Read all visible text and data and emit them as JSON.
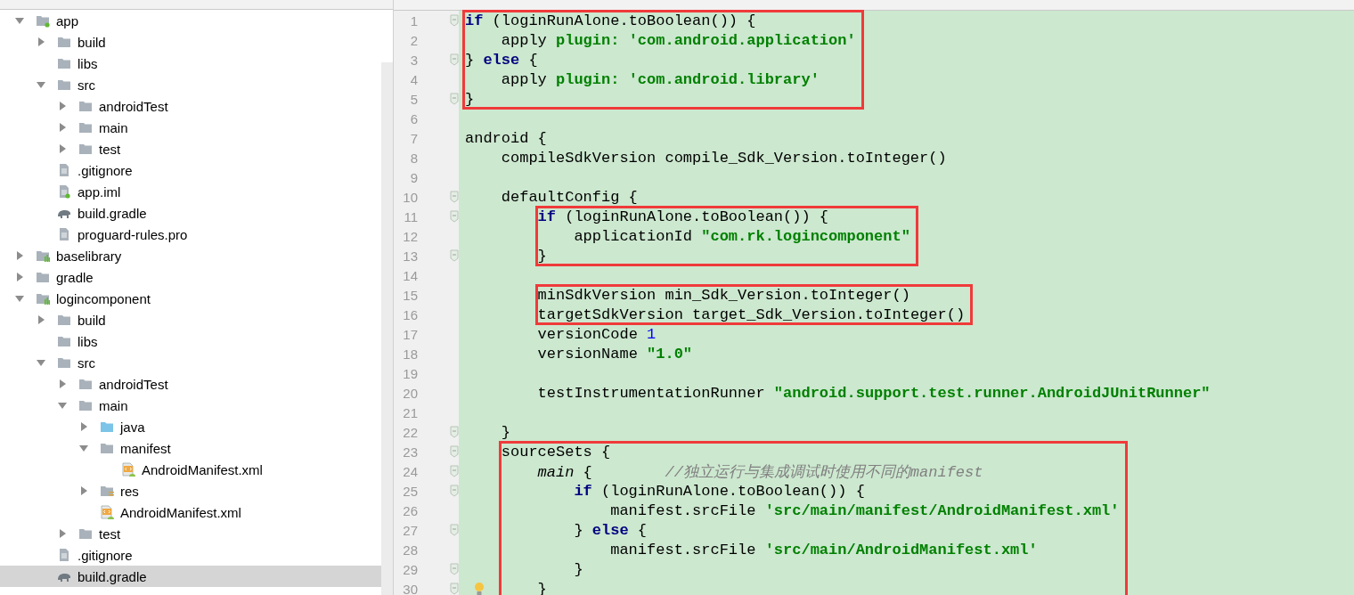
{
  "tree": [
    {
      "label": "app",
      "kind": "app-module",
      "expanded": true,
      "selected": false,
      "children": [
        {
          "label": "build",
          "kind": "folder",
          "expanded": false,
          "selected": false
        },
        {
          "label": "libs",
          "kind": "folder",
          "selected": false
        },
        {
          "label": "src",
          "kind": "folder",
          "expanded": true,
          "selected": false,
          "children": [
            {
              "label": "androidTest",
              "kind": "folder",
              "expanded": false,
              "selected": false
            },
            {
              "label": "main",
              "kind": "folder",
              "expanded": false,
              "selected": false
            },
            {
              "label": "test",
              "kind": "folder",
              "expanded": false,
              "selected": false
            }
          ]
        },
        {
          "label": ".gitignore",
          "kind": "file",
          "selected": false
        },
        {
          "label": "app.iml",
          "kind": "iml",
          "selected": false
        },
        {
          "label": "build.gradle",
          "kind": "gradle",
          "selected": false
        },
        {
          "label": "proguard-rules.pro",
          "kind": "file",
          "selected": false
        }
      ]
    },
    {
      "label": "baselibrary",
      "kind": "lib-module",
      "expanded": false,
      "selected": false
    },
    {
      "label": "gradle",
      "kind": "folder",
      "expanded": false,
      "selected": false
    },
    {
      "label": "logincomponent",
      "kind": "lib-module",
      "expanded": true,
      "selected": false,
      "children": [
        {
          "label": "build",
          "kind": "folder",
          "expanded": false,
          "selected": false
        },
        {
          "label": "libs",
          "kind": "folder",
          "selected": false
        },
        {
          "label": "src",
          "kind": "folder",
          "expanded": true,
          "selected": false,
          "children": [
            {
              "label": "androidTest",
              "kind": "folder",
              "expanded": false,
              "selected": false
            },
            {
              "label": "main",
              "kind": "folder",
              "expanded": true,
              "selected": false,
              "children": [
                {
                  "label": "java",
                  "kind": "source-folder",
                  "expanded": false,
                  "selected": false
                },
                {
                  "label": "manifest",
                  "kind": "folder",
                  "expanded": true,
                  "selected": false,
                  "children": [
                    {
                      "label": "AndroidManifest.xml",
                      "kind": "xml",
                      "selected": false
                    }
                  ]
                },
                {
                  "label": "res",
                  "kind": "res-folder",
                  "expanded": false,
                  "selected": false
                },
                {
                  "label": "AndroidManifest.xml",
                  "kind": "xml",
                  "selected": false
                }
              ]
            },
            {
              "label": "test",
              "kind": "folder",
              "expanded": false,
              "selected": false
            }
          ]
        },
        {
          "label": ".gitignore",
          "kind": "file",
          "selected": false
        },
        {
          "label": "build.gradle",
          "kind": "gradle",
          "selected": true
        }
      ]
    }
  ],
  "code": [
    {
      "boxed": true,
      "lines": [
        {
          "number": "1",
          "fold": true,
          "bulb": false,
          "segments": [
            {
              "kind": "keyword",
              "text": "if"
            },
            {
              "kind": "plain",
              "text": " (loginRunAlone.toBoolean()) {"
            }
          ]
        },
        {
          "number": "2",
          "fold": false,
          "bulb": false,
          "segments": [
            {
              "kind": "plain",
              "text": "    apply "
            },
            {
              "kind": "string",
              "text": "plugin: 'com.android.application'"
            }
          ]
        },
        {
          "number": "3",
          "fold": true,
          "bulb": false,
          "segments": [
            {
              "kind": "plain",
              "text": "} "
            },
            {
              "kind": "keyword",
              "text": "else"
            },
            {
              "kind": "plain",
              "text": " {"
            }
          ]
        },
        {
          "number": "4",
          "fold": false,
          "bulb": false,
          "segments": [
            {
              "kind": "plain",
              "text": "    apply "
            },
            {
              "kind": "string",
              "text": "plugin: 'com.android.library'"
            }
          ]
        },
        {
          "number": "5",
          "fold": true,
          "bulb": false,
          "segments": [
            {
              "kind": "plain",
              "text": "}"
            }
          ]
        }
      ]
    },
    {
      "boxed": false,
      "lines": [
        {
          "number": "6",
          "fold": false,
          "bulb": false
        },
        {
          "number": "7",
          "fold": false,
          "bulb": false,
          "segments": [
            {
              "kind": "plain",
              "text": "android {"
            }
          ]
        },
        {
          "number": "8",
          "fold": false,
          "bulb": false,
          "segments": [
            {
              "kind": "plain",
              "text": "    compileSdkVersion compile_Sdk_Version.toInteger()"
            }
          ]
        },
        {
          "number": "9",
          "fold": false,
          "bulb": false
        },
        {
          "number": "10",
          "fold": true,
          "bulb": false,
          "segments": [
            {
              "kind": "plain",
              "text": "    defaultConfig {"
            }
          ]
        }
      ]
    },
    {
      "boxed": true,
      "lines": [
        {
          "number": "11",
          "fold": true,
          "bulb": false,
          "segments": [
            {
              "kind": "keyword",
              "text": "        if"
            },
            {
              "kind": "plain",
              "text": " (loginRunAlone.toBoolean()) {"
            }
          ]
        },
        {
          "number": "12",
          "fold": false,
          "bulb": false,
          "segments": [
            {
              "kind": "plain",
              "text": "            applicationId "
            },
            {
              "kind": "string",
              "text": "\"com.rk.logincomponent\""
            }
          ]
        },
        {
          "number": "13",
          "fold": true,
          "bulb": false,
          "segments": [
            {
              "kind": "plain",
              "text": "        }"
            }
          ]
        }
      ]
    },
    {
      "boxed": false,
      "lines": [
        {
          "number": "14",
          "fold": false,
          "bulb": false
        }
      ]
    },
    {
      "boxed": true,
      "lines": [
        {
          "number": "15",
          "fold": false,
          "bulb": false,
          "segments": [
            {
              "kind": "plain",
              "text": "        minSdkVersion min_Sdk_Version.toInteger()"
            }
          ]
        },
        {
          "number": "16",
          "fold": false,
          "bulb": false,
          "segments": [
            {
              "kind": "plain",
              "text": "        targetSdkVersion target_Sdk_Version.toInteger()"
            }
          ]
        }
      ]
    },
    {
      "boxed": false,
      "lines": [
        {
          "number": "17",
          "fold": false,
          "bulb": false,
          "segments": [
            {
              "kind": "plain",
              "text": "        versionCode "
            },
            {
              "kind": "number",
              "text": "1"
            }
          ]
        },
        {
          "number": "18",
          "fold": false,
          "bulb": false,
          "segments": [
            {
              "kind": "plain",
              "text": "        versionName "
            },
            {
              "kind": "string",
              "text": "\"1.0\""
            }
          ]
        },
        {
          "number": "19",
          "fold": false,
          "bulb": false
        },
        {
          "number": "20",
          "fold": false,
          "bulb": false,
          "segments": [
            {
              "kind": "plain",
              "text": "        testInstrumentationRunner "
            },
            {
              "kind": "string",
              "text": "\"android.support.test.runner.AndroidJUnitRunner\""
            }
          ]
        },
        {
          "number": "21",
          "fold": false,
          "bulb": false
        },
        {
          "number": "22",
          "fold": true,
          "bulb": false,
          "segments": [
            {
              "kind": "plain",
              "text": "    }"
            }
          ]
        }
      ]
    },
    {
      "boxed": true,
      "lines": [
        {
          "number": "23",
          "fold": true,
          "bulb": false,
          "segments": [
            {
              "kind": "plain",
              "text": "    sourceSets {"
            }
          ]
        },
        {
          "number": "24",
          "fold": true,
          "bulb": false,
          "segments": [
            {
              "kind": "italic",
              "text": "        main"
            },
            {
              "kind": "plain",
              "text": " {        "
            },
            {
              "kind": "comment",
              "text": "//独立运行与集成调试时使用不同的manifest"
            }
          ]
        },
        {
          "number": "25",
          "fold": true,
          "bulb": false,
          "segments": [
            {
              "kind": "keyword",
              "text": "            if"
            },
            {
              "kind": "plain",
              "text": " (loginRunAlone.toBoolean()) {"
            }
          ]
        },
        {
          "number": "26",
          "fold": false,
          "bulb": false,
          "segments": [
            {
              "kind": "plain",
              "text": "                manifest.srcFile "
            },
            {
              "kind": "string",
              "text": "'src/main/manifest/AndroidManifest.xml'"
            }
          ]
        },
        {
          "number": "27",
          "fold": true,
          "bulb": false,
          "segments": [
            {
              "kind": "plain",
              "text": "            } "
            },
            {
              "kind": "keyword",
              "text": "else"
            },
            {
              "kind": "plain",
              "text": " {"
            }
          ]
        },
        {
          "number": "28",
          "fold": false,
          "bulb": false,
          "segments": [
            {
              "kind": "plain",
              "text": "                manifest.srcFile "
            },
            {
              "kind": "string",
              "text": "'src/main/AndroidManifest.xml'"
            }
          ]
        },
        {
          "number": "29",
          "fold": true,
          "bulb": false,
          "segments": [
            {
              "kind": "plain",
              "text": "            }"
            }
          ]
        },
        {
          "number": "30",
          "fold": true,
          "bulb": true,
          "segments": [
            {
              "kind": "plain",
              "text": "        }"
            }
          ]
        }
      ]
    }
  ]
}
